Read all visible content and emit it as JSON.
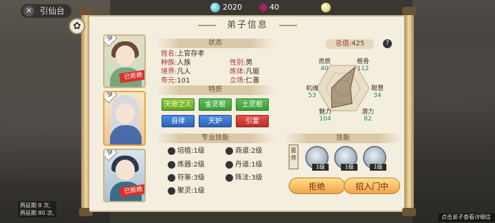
{
  "header": {
    "back_label": "引仙台",
    "currencies": [
      {
        "icon": "spirit-stone-icon",
        "value": "2020"
      },
      {
        "icon": "gem-icon",
        "value": "40"
      },
      {
        "icon": "coin-icon",
        "value": ""
      }
    ]
  },
  "panel": {
    "title": "弟子信息"
  },
  "portraits": [
    {
      "role": "待定",
      "rejected": "已拒绝"
    },
    {
      "role": "待定",
      "rejected": ""
    },
    {
      "role": "待定",
      "rejected": "已拒绝"
    }
  ],
  "status": {
    "heading": "状态",
    "name_k": "姓名:",
    "name_v": "上官存孝",
    "race_k": "种族:",
    "race_v": "人族",
    "gender_k": "性别:",
    "gender_v": "男",
    "realm_k": "境界:",
    "realm_v": "凡人",
    "body_k": "炼体:",
    "body_v": "凡躯",
    "life_k": "寿元:",
    "life_v": "101",
    "stance_k": "立场:",
    "stance_v": "仁善"
  },
  "traits": {
    "heading": "特质",
    "items": [
      "天命之人",
      "金灵根",
      "土灵根",
      "自律",
      "天妒",
      "引雷"
    ]
  },
  "skills": {
    "heading": "专业技能",
    "items": [
      {
        "label": "培植:",
        "level": "1级"
      },
      {
        "label": "商道:",
        "level": "2级"
      },
      {
        "label": "炼器:",
        "level": "2级"
      },
      {
        "label": "丹道:",
        "level": "1级"
      },
      {
        "label": "符箓:",
        "level": "3级"
      },
      {
        "label": "阵法:",
        "level": "3级"
      },
      {
        "label": "聚灵:",
        "level": "1级"
      }
    ]
  },
  "stats": {
    "total_k": "总值:",
    "total_v": "425",
    "help": "?",
    "items": [
      {
        "label": "资质",
        "value": 40
      },
      {
        "label": "根骨",
        "value": 112
      },
      {
        "label": "机缘",
        "value": 53
      },
      {
        "label": "聪慧",
        "value": 34
      },
      {
        "label": "魅力",
        "value": 104
      },
      {
        "label": "潜力",
        "value": 82
      }
    ]
  },
  "techniques": {
    "heading": "技能",
    "badge": "面师",
    "items": [
      {
        "icon": "sword-spirit-icon",
        "level": "1级"
      },
      {
        "icon": "wind-blade-icon",
        "level": "1级"
      },
      {
        "icon": "crane-icon",
        "level": "1级"
      }
    ]
  },
  "actions": {
    "reject": "拒绝",
    "recruit": "招入门中"
  },
  "tip": "点击弟子查看详细信息",
  "bottom_left": {
    "line1": "再延期 8 次,",
    "line2": "再延期 80 次,"
  }
}
